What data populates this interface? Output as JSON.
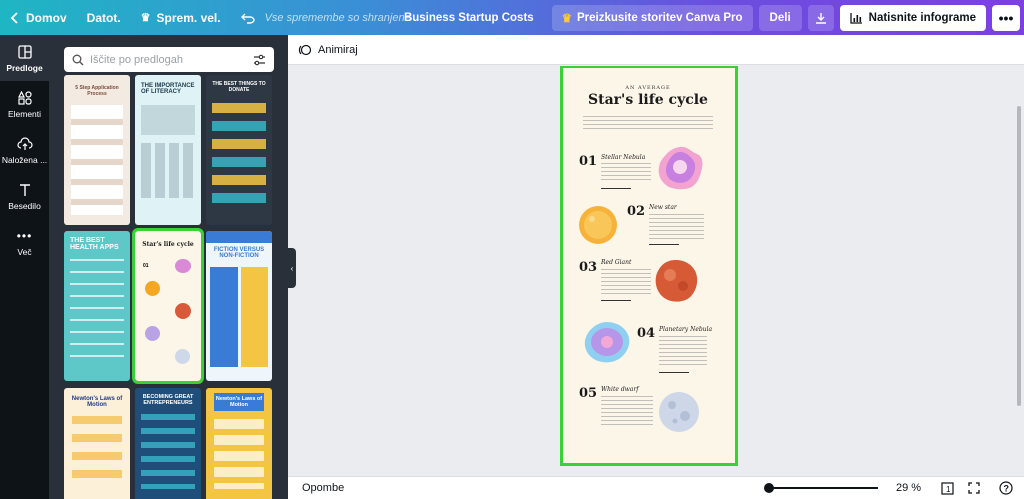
{
  "topbar": {
    "home": "Domov",
    "file": "Datot.",
    "resize": "Sprem. vel.",
    "saved_status": "Vse spremembe so shranjene",
    "doc_title": "Business Startup Costs",
    "try_pro": "Preizkusite storitev Canva Pro",
    "share": "Deli",
    "print": "Natisnite infograme",
    "more": "•••"
  },
  "rail": {
    "items": [
      {
        "label": "Predloge",
        "icon": "templates-icon"
      },
      {
        "label": "Elementi",
        "icon": "elements-icon"
      },
      {
        "label": "Naložena ...",
        "icon": "upload-icon"
      },
      {
        "label": "Besedilo",
        "icon": "text-icon"
      },
      {
        "label": "Več",
        "icon": "more-icon"
      }
    ]
  },
  "panel": {
    "search_placeholder": "Iščite po predlogah",
    "thumbs": [
      {
        "title": "5 Step Application Process"
      },
      {
        "title": "THE IMPORTANCE OF LITERACY"
      },
      {
        "title": "THE BEST THINGS TO DONATE"
      },
      {
        "title": "THE BEST HEALTH APPS"
      },
      {
        "title": "Star's life cycle"
      },
      {
        "title": "FICTION VERSUS NON-FICTION"
      },
      {
        "title": "Newton's Laws of Motion"
      },
      {
        "title": "BECOMING GREAT ENTREPRENEURS"
      },
      {
        "title": "Newton's Laws of Motion"
      }
    ]
  },
  "canvas": {
    "animate": "Animiraj",
    "kicker": "AN AVERAGE",
    "title": "Star's life cycle",
    "stages": [
      {
        "num": "01",
        "name": "Stellar Nebula"
      },
      {
        "num": "02",
        "name": "New star"
      },
      {
        "num": "03",
        "name": "Red Giant"
      },
      {
        "num": "04",
        "name": "Planetary Nebula"
      },
      {
        "num": "05",
        "name": "White dwarf"
      }
    ]
  },
  "footer": {
    "notes": "Opombe",
    "zoom": "29 %",
    "page_count": "1",
    "help": "?"
  },
  "colors": {
    "selection": "#3ad137",
    "rail_bg": "#0e1318",
    "panel_bg": "#293039",
    "page_bg": "#fcf6e8"
  }
}
